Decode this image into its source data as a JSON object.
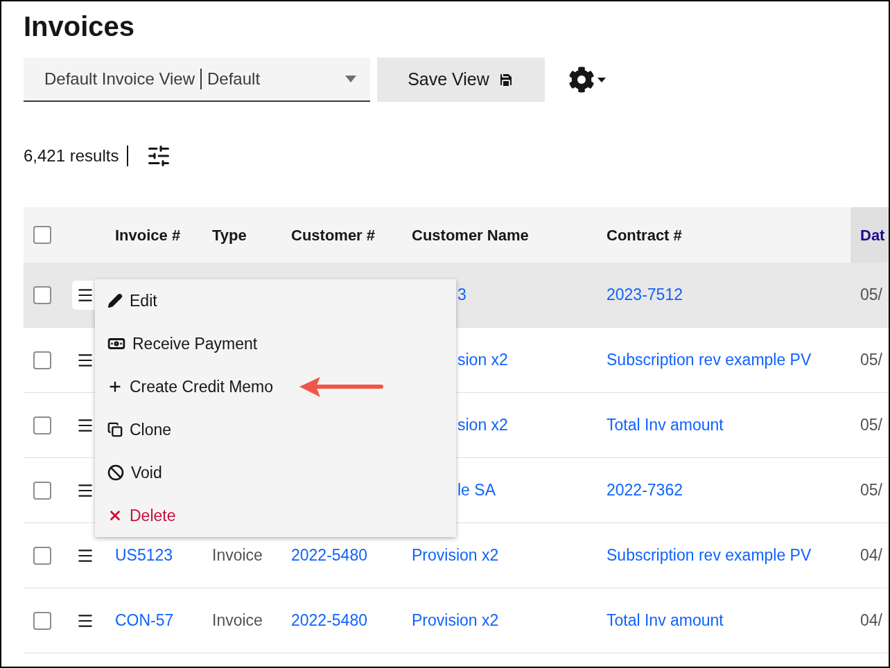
{
  "title": "Invoices",
  "view_select": {
    "value": "Default Invoice View",
    "suffix": "Default"
  },
  "save_button": "Save View",
  "results": "6,421 results",
  "table": {
    "select_all": {
      "checked": false
    },
    "columns": [
      {
        "label": "Invoice #",
        "sorted": false
      },
      {
        "label": "Type",
        "sorted": false
      },
      {
        "label": "Customer #",
        "sorted": false
      },
      {
        "label": "Customer Name",
        "sorted": false
      },
      {
        "label": "Contract #",
        "sorted": false
      },
      {
        "label": "Dat",
        "sorted": true
      }
    ],
    "rows": [
      {
        "selected": true,
        "checked": false,
        "customer_name": "3",
        "contract": "2023-7512",
        "date": "05/"
      },
      {
        "selected": false,
        "checked": false,
        "customer_name": "sion x2",
        "contract": "Subscription rev example PV",
        "date": "05/"
      },
      {
        "selected": false,
        "checked": false,
        "customer_name": "sion x2",
        "contract": "Total Inv amount",
        "date": "05/"
      },
      {
        "selected": false,
        "checked": false,
        "customer_name": "le SA",
        "contract": "2022-7362",
        "date": "05/"
      },
      {
        "selected": false,
        "checked": false,
        "invoice": "US5123",
        "type": "Invoice",
        "customer_no": "2022-5480",
        "customer_name": "Provision x2",
        "contract": "Subscription rev example PV",
        "date": "04/"
      },
      {
        "selected": false,
        "checked": false,
        "invoice": "CON-57",
        "type": "Invoice",
        "customer_no": "2022-5480",
        "customer_name": "Provision x2",
        "contract": "Total Inv amount",
        "date": "04/"
      }
    ]
  },
  "row_menu": {
    "items": [
      {
        "kind": "edit",
        "label": "Edit"
      },
      {
        "kind": "payment",
        "label": "Receive Payment"
      },
      {
        "kind": "create",
        "label": "Create Credit Memo"
      },
      {
        "kind": "clone",
        "label": "Clone"
      },
      {
        "kind": "void",
        "label": "Void"
      },
      {
        "kind": "delete",
        "label": "Delete"
      }
    ]
  }
}
